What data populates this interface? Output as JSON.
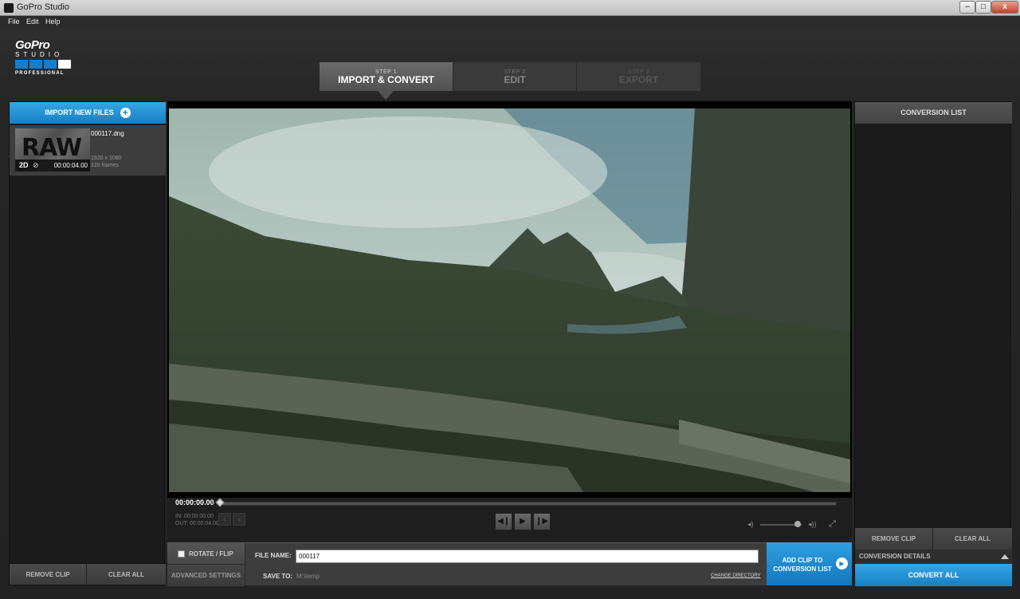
{
  "window": {
    "title": "GoPro Studio",
    "minimize": "–",
    "maximize": "□",
    "close": "x"
  },
  "menu": {
    "file": "File",
    "edit": "Edit",
    "help": "Help"
  },
  "logo": {
    "brand": "GoPro",
    "studio": "STUDIO",
    "edition": "PROFESSIONAL",
    "colors": [
      "#0f7fd2",
      "#0f7fd2",
      "#0f7fd2",
      "#ffffff"
    ]
  },
  "steps": [
    {
      "number": "STEP 1",
      "label": "IMPORT & CONVERT",
      "state": "active"
    },
    {
      "number": "STEP 2",
      "label": "EDIT",
      "state": "inactive"
    },
    {
      "number": "STEP 3",
      "label": "EXPORT",
      "state": "disabled"
    }
  ],
  "left_panel": {
    "import_label": "IMPORT NEW FILES",
    "clip": {
      "badge": "RAW",
      "mode": "2D",
      "link_glyph": "⊘",
      "duration": "00:00:04.00",
      "filename": "000117.dng",
      "resolution": "1920 x 1080",
      "frames": "120 frames"
    },
    "remove_clip": "REMOVE CLIP",
    "clear_all": "CLEAR ALL"
  },
  "player": {
    "timecode": "00:00:00.00",
    "in_point": "IN: 00:00:00.00",
    "out_point": "OUT: 00:00:04.00",
    "mark_in": "‹",
    "mark_out": "›",
    "prev_frame": "◀❙",
    "play": "▶",
    "next_frame": "❙▶",
    "volume_low": "◂)",
    "volume_high": "◂))",
    "fullscreen": "⤢",
    "volume_level": 0.9,
    "progress": 0
  },
  "bottom": {
    "rotate_flip": "ROTATE / FLIP",
    "advanced_settings": "ADVANCED SETTINGS",
    "file_name_label": "FILE NAME:",
    "file_name_value": "000117",
    "save_to_label": "SAVE TO:",
    "save_to_path": "M:\\temp",
    "change_directory": "CHANGE DIRECTORY",
    "add_clip": "ADD CLIP TO CONVERSION LIST",
    "add_clip_glyph": "▶"
  },
  "right_panel": {
    "header": "CONVERSION LIST",
    "remove_clip": "REMOVE CLIP",
    "clear_all": "CLEAR ALL",
    "details": "CONVERSION DETAILS",
    "convert_all": "CONVERT ALL"
  },
  "colors": {
    "accent": "#1b8fd6",
    "panel": "#1b1b1b",
    "frame": "#262626"
  }
}
